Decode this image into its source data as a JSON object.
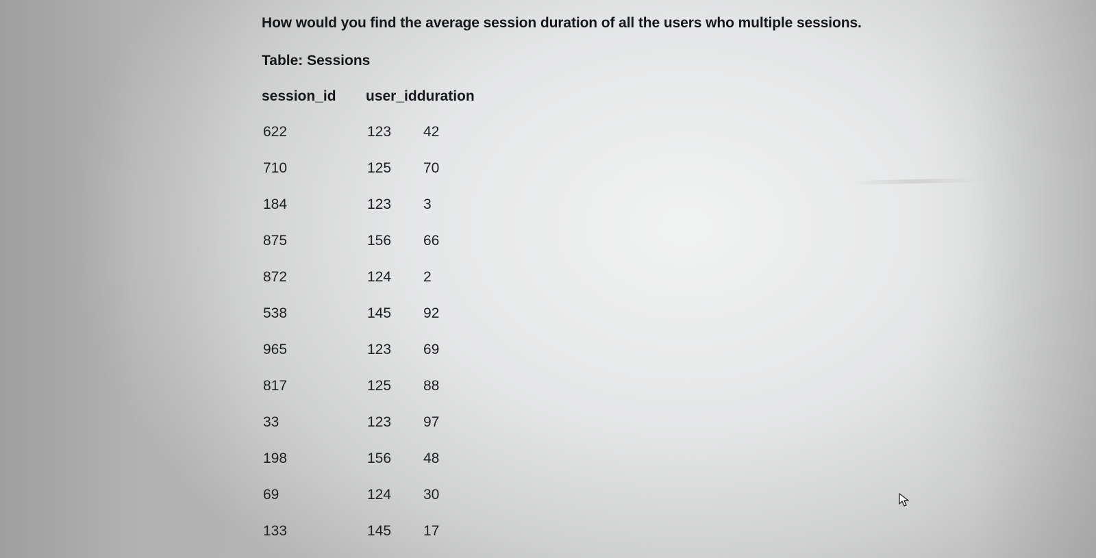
{
  "question": "How would you find the average session duration of all the users who multiple sessions.",
  "table_title": "Table: Sessions",
  "headers": {
    "session_id": "session_id",
    "user_id_duration": "user_idduration"
  },
  "rows": [
    {
      "session_id": "622",
      "user_id": "123",
      "duration": "42"
    },
    {
      "session_id": "710",
      "user_id": "125",
      "duration": "70"
    },
    {
      "session_id": "184",
      "user_id": "123",
      "duration": "3"
    },
    {
      "session_id": "875",
      "user_id": "156",
      "duration": "66"
    },
    {
      "session_id": "872",
      "user_id": "124",
      "duration": "2"
    },
    {
      "session_id": "538",
      "user_id": "145",
      "duration": "92"
    },
    {
      "session_id": "965",
      "user_id": "123",
      "duration": "69"
    },
    {
      "session_id": "817",
      "user_id": "125",
      "duration": "88"
    },
    {
      "session_id": "33",
      "user_id": "123",
      "duration": "97"
    },
    {
      "session_id": "198",
      "user_id": "156",
      "duration": "48"
    },
    {
      "session_id": "69",
      "user_id": "124",
      "duration": "30"
    },
    {
      "session_id": "133",
      "user_id": "145",
      "duration": "17"
    }
  ],
  "cursor_icon": "mouse-pointer-icon"
}
